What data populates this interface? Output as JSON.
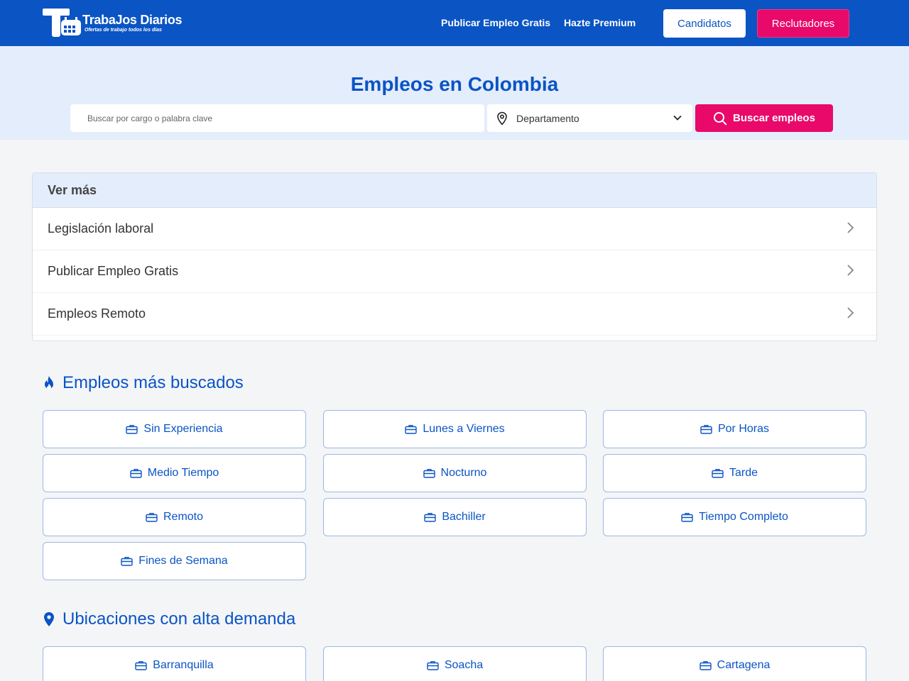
{
  "header": {
    "logo_title": "TrabaJos Diarios",
    "logo_tagline": "Ofertas de trabajo todos los días",
    "nav": [
      "Publicar Empleo Gratis",
      "Hazte Premium"
    ],
    "candidates_button": "Candidatos",
    "recruiters_button": "Reclutadores"
  },
  "hero": {
    "title": "Empleos en Colombia",
    "search_placeholder": "Buscar por cargo o palabra clave",
    "department_select": "Departamento",
    "search_button": "Buscar empleos"
  },
  "more": {
    "heading": "Ver más",
    "items": [
      "Legislación laboral",
      "Publicar Empleo Gratis",
      "Empleos Remoto"
    ]
  },
  "popular": {
    "title": "Empleos más buscados",
    "items": [
      "Sin Experiencia",
      "Lunes a Viernes",
      "Por Horas",
      "Medio Tiempo",
      "Nocturno",
      "Tarde",
      "Remoto",
      "Bachiller",
      "Tiempo Completo",
      "Fines de Semana"
    ]
  },
  "locations": {
    "title": "Ubicaciones con alta demanda",
    "items": [
      "Barranquilla",
      "Soacha",
      "Cartagena"
    ]
  },
  "colors": {
    "primary": "#0a54c4",
    "accent": "#e9096a",
    "hero_bg": "#e4edfc"
  },
  "icons": {
    "popular": "fire-icon",
    "locations": "location-pin-icon",
    "chip": "briefcase-icon"
  }
}
